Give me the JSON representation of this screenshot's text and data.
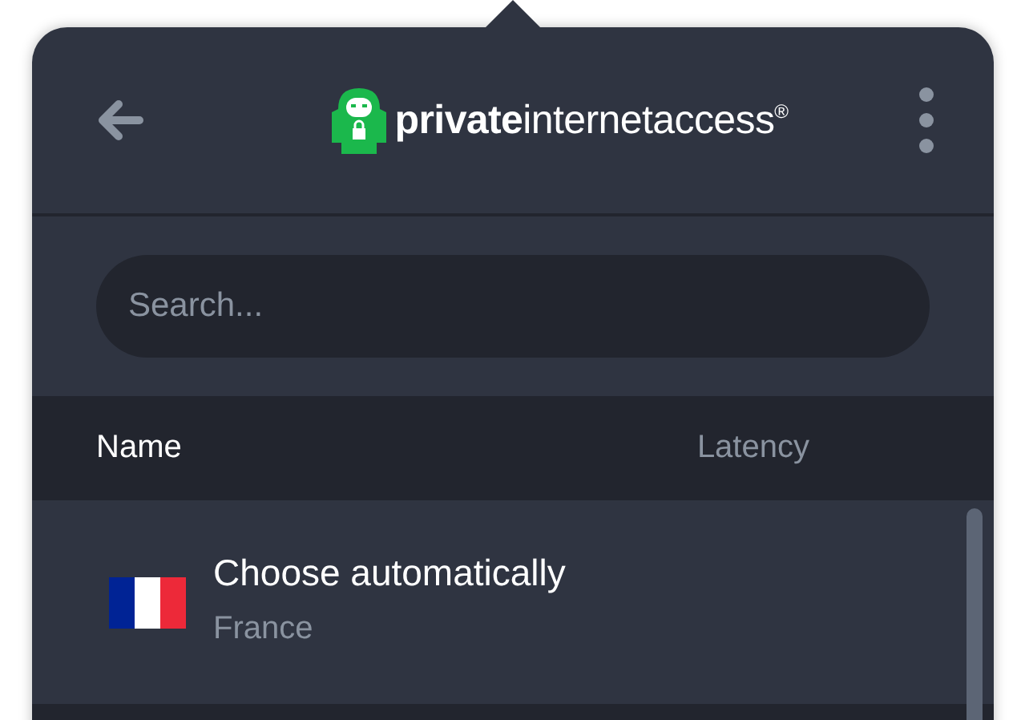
{
  "header": {
    "logo_text": "**private**internetaccess$^{®}$"
  },
  "search": {
    "placeholder": "Search..."
  },
  "table": {
    "columns": [
      "Name",
      "Latency"
    ],
    "rows": [
      {
        "name": "Choose automatically",
        "country": "France",
        "kind": "france"
      }
    ]
  }
}
